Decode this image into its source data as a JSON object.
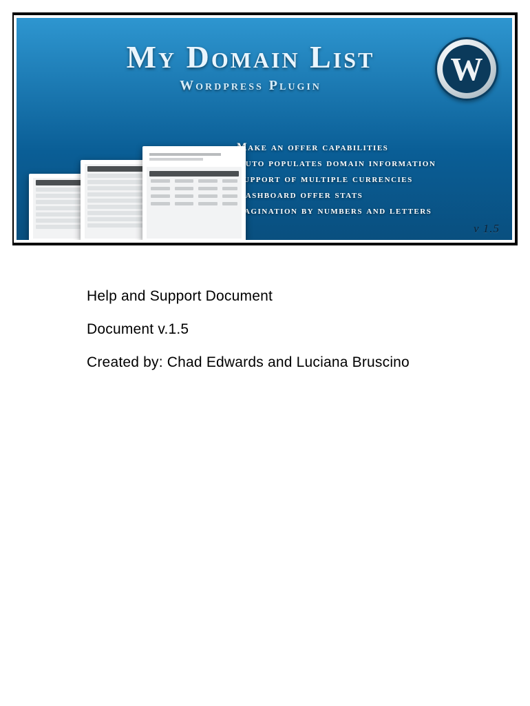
{
  "banner": {
    "title": "My Domain List",
    "subtitle": "Wordpress Plugin",
    "version": "v 1.5",
    "features": [
      "Make an offer capabilities",
      "Auto populates domain information",
      "Support of multiple currencies",
      "Dashboard offer stats",
      "Pagination by numbers and letters"
    ]
  },
  "content": {
    "line1": "Help and Support Document",
    "line2": "Document v.1.5",
    "line3": "Created by: Chad Edwards and Luciana Bruscino"
  }
}
